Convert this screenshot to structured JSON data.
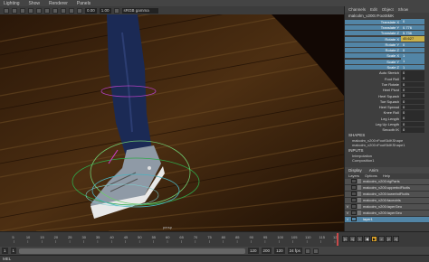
{
  "menubar": {
    "items": [
      "Lighting",
      "Show",
      "Renderer",
      "Panels"
    ]
  },
  "toolbar": {
    "field1": "0.00",
    "field2": "1.00",
    "colorspace": "sRGB gamma"
  },
  "viewport": {
    "label": "persp"
  },
  "channelbox": {
    "tabs": [
      "Channels",
      "Edit",
      "Object",
      "Show"
    ],
    "object_name": "malcolm_v200:rFootSkIK",
    "attributes": [
      {
        "label": "Translate X",
        "value": "0",
        "state": "sel"
      },
      {
        "label": "Translate Y",
        "value": "0.776",
        "state": "sel"
      },
      {
        "label": "Translate Z",
        "value": "5.736",
        "state": "sel"
      },
      {
        "label": "Rotate X",
        "value": "45.627",
        "state": "key"
      },
      {
        "label": "Rotate Y",
        "value": "0",
        "state": "sel"
      },
      {
        "label": "Rotate Z",
        "value": "0",
        "state": "sel"
      },
      {
        "label": "Scale X",
        "value": "1",
        "state": "sel"
      },
      {
        "label": "Scale Y",
        "value": "1",
        "state": "sel"
      },
      {
        "label": "Scale Z",
        "value": "1",
        "state": "sel"
      },
      {
        "label": "Auto Stretch",
        "value": "0",
        "state": ""
      },
      {
        "label": "Foot Roll",
        "value": "0",
        "state": ""
      },
      {
        "label": "Toe Rotate",
        "value": "0",
        "state": ""
      },
      {
        "label": "Heel Pivot",
        "value": "0",
        "state": ""
      },
      {
        "label": "Heel Squash",
        "value": "0",
        "state": ""
      },
      {
        "label": "Toe Squash",
        "value": "0",
        "state": ""
      },
      {
        "label": "Heel Spread",
        "value": "0",
        "state": ""
      },
      {
        "label": "Knee Roll",
        "value": "0",
        "state": ""
      },
      {
        "label": "Leg Length",
        "value": "0",
        "state": ""
      },
      {
        "label": "Leg Up Length",
        "value": "0",
        "state": ""
      },
      {
        "label": "Smooth IK",
        "value": "0",
        "state": ""
      }
    ],
    "shapes_header": "SHAPES",
    "shapes": [
      "malcolm_v200:rFootSkIKShape",
      "malcolm_v200:rFootSkIKShape1"
    ],
    "inputs_header": "INPUTS",
    "inputs": [
      "Interpolation",
      "Composition1"
    ]
  },
  "layers": {
    "tabs": [
      "Display",
      "Anim"
    ],
    "menu": [
      "Layers",
      "Options",
      "Help"
    ],
    "items": [
      {
        "v": "",
        "name": "malcolm_v200:rigParts",
        "color": "#777"
      },
      {
        "v": "",
        "name": "malcolm_v200:upperbdFkctls",
        "color": "#777"
      },
      {
        "v": "",
        "name": "malcolm_v200:lowerbdFkctls",
        "color": "#777"
      },
      {
        "v": "",
        "name": "malcolm_v200:facectrls",
        "color": "#777"
      },
      {
        "v": "V",
        "name": "malcolm_v200:layerGeo",
        "color": "#777"
      },
      {
        "v": "V",
        "name": "malcolm_v200:layerGeo",
        "color": "#777"
      },
      {
        "v": "V",
        "name": "layer1",
        "color": "#5285a6"
      }
    ]
  },
  "timeline": {
    "ticks": [
      "5",
      "10",
      "15",
      "20",
      "25",
      "30",
      "35",
      "40",
      "45",
      "50",
      "55",
      "60",
      "65",
      "70",
      "75",
      "80",
      "85",
      "90",
      "95",
      "100",
      "105",
      "110",
      "115",
      "120"
    ]
  },
  "range": {
    "start": "1",
    "start2": "1",
    "end": "120",
    "end2": "200",
    "current": "120",
    "fps": "24 fps"
  },
  "cmdline": {
    "label": "MEL"
  },
  "colors": {
    "selected": "#5285a6",
    "keyed": "#c8b04a"
  }
}
